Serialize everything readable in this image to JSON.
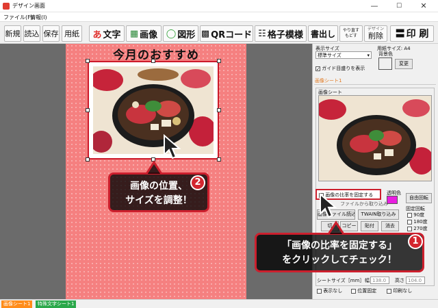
{
  "window": {
    "title": "デザイン画面",
    "min": "—",
    "max": "☐",
    "close": "✕"
  },
  "menu": [
    "ファイル(F)",
    "情報(I)"
  ],
  "toolbar": {
    "small": [
      "新規",
      "読込",
      "保存",
      "用紙"
    ],
    "tools": [
      {
        "icon": "あ",
        "label": "文字"
      },
      {
        "icon": "▦",
        "label": "画像"
      },
      {
        "icon": "◯",
        "label": "図形"
      },
      {
        "icon": "▩",
        "label": "QRコード"
      },
      {
        "icon": "☷",
        "label": "格子模様"
      }
    ],
    "kakidashi": "書出し",
    "redo_top": "やり直す",
    "redo_bottom": "もどす",
    "design_delete_small": "デザイン",
    "design_delete": "削除",
    "print_icon": "〓",
    "print": "印 刷"
  },
  "canvas": {
    "headline": "今月のおすすめ"
  },
  "panel": {
    "display_size_label": "表示サイズ",
    "display_size_value": "標準サイズ",
    "paper_size": "用紙サイズ: A4",
    "bg_color_label": "背景色",
    "bg_color_value": "#f08080",
    "change_button": "変更",
    "guide_label": "ガイド目盛りを表示",
    "sheet_tab": "画像シート1",
    "sheet_group": "画像シート",
    "fix_ratio": "画像の比率を固定する",
    "transparent_label": "透明色",
    "transparent_color": "#e81ee0",
    "free_rotate": "自由回転",
    "fixed_rotate": "固定回転",
    "rotations": [
      "90度",
      "180度",
      "270度"
    ],
    "partial_caption": "ファイルから取り込み",
    "file_button": "ファイル読込",
    "file_button_prefix": "画像",
    "twain_button": "TWAIN取り込み",
    "cut_button": "切",
    "copy_button": "コピー",
    "paste_button": "貼付",
    "delete_button": "消去",
    "sheet_size_label": "シートサイズ［mm］",
    "width_label": "幅",
    "width_value": "138.0",
    "height_label": "高さ",
    "height_value": "104.0",
    "hide_label": "表示なし",
    "pos_lock_label": "位置固定",
    "no_print_label": "印刷なし"
  },
  "status_tabs": [
    "画像シート1",
    "特殊文字シート1"
  ],
  "callouts": {
    "c1_line1": "「画像の比率を固定する」",
    "c1_line2": "をクリックしてチェック！",
    "c1_num": "1",
    "c2_line1": "画像の位置、",
    "c2_line2": "サイズを調整！",
    "c2_num": "2"
  },
  "colors": {
    "accent": "#d3262f",
    "sheet": "#f58080",
    "tab_orange": "#ff8c1a",
    "tab_green": "#2aa84a"
  }
}
